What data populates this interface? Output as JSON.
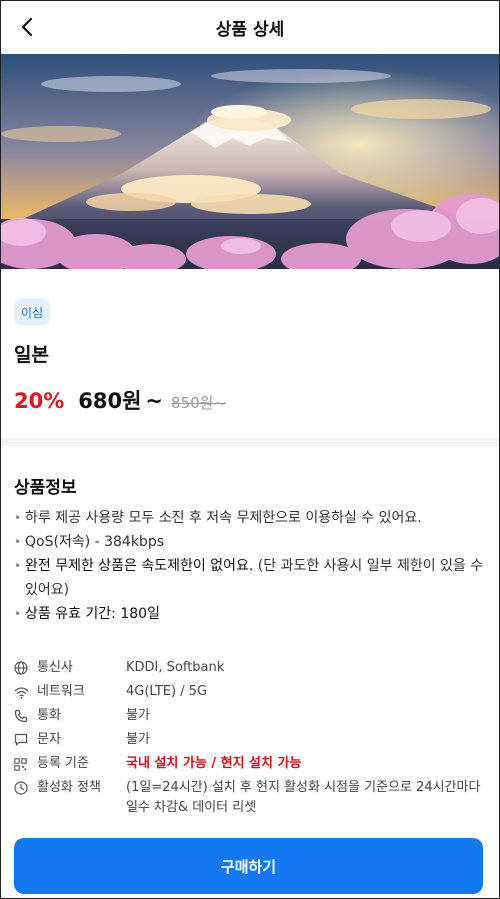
{
  "header": {
    "title": "상품 상세",
    "back_icon": "chevron-left-icon"
  },
  "badge": {
    "label": "이심"
  },
  "product": {
    "country": "일본",
    "discount": "20%",
    "price": "680원",
    "price_suffix": "~",
    "original_price": "850원~"
  },
  "info": {
    "title": "상품정보",
    "bullets": [
      {
        "text": "하루 제공 사용량 모두 소진 후 저속 무제한으로 이용하실 수 있어요."
      },
      {
        "text": "QoS(저속) - 384kbps"
      },
      {
        "strong": "완전 무제한 상품은 속도제한이 없어요.",
        "text": " (단 과도한 사용시 일부 제한이 있을 수 있어요)"
      },
      {
        "text": "상품 유효 기간: 180일"
      }
    ]
  },
  "specs": [
    {
      "icon": "globe-icon",
      "label": "통신사",
      "value": "KDDI, Softbank"
    },
    {
      "icon": "wifi-icon",
      "label": "네트워크",
      "value": "4G(LTE) / 5G"
    },
    {
      "icon": "phone-icon",
      "label": "통화",
      "value": "불가"
    },
    {
      "icon": "message-icon",
      "label": "문자",
      "value": "불가"
    },
    {
      "icon": "qr-icon",
      "label": "등록 기준",
      "value": "국내 설치 가능 / 현지 설치 가능",
      "highlight": true
    },
    {
      "icon": "clock-icon",
      "label": "활성화 정책",
      "value": "(1일=24시간) 설치 후 현지 활성화 시점을 기준으로 24시간마다 일수 차감& 데이터 리셋"
    }
  ],
  "buy_button": {
    "label": "구매하기"
  },
  "colors": {
    "accent": "#1479f0",
    "discount": "#e0141e",
    "badge_bg": "#e6f0fb",
    "badge_text": "#2b73c9"
  }
}
